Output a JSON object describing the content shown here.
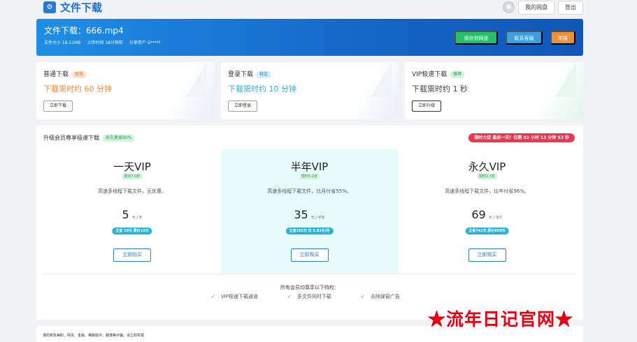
{
  "brand": {
    "logo_glyph": "⚙",
    "name": "文件下载"
  },
  "topbar": {
    "my_disk": "我的网盘",
    "logout": "登出"
  },
  "file": {
    "title": "文件下载：666.mp4",
    "size": "文件大小 18.51MB",
    "upload_time": "上传时间 18分钟前",
    "sharer": "分享用户 G****l"
  },
  "header_buttons": {
    "save": "保存到网盘",
    "contact": "联系客服",
    "report": "举报"
  },
  "download_options": [
    {
      "title": "普通下载",
      "badge": "极慢",
      "time": "下载需时约 60 分钟",
      "button": "立即下载"
    },
    {
      "title": "登录下载",
      "badge": "稳定",
      "time": "下载需时约 10 分钟",
      "button": "立即登录"
    },
    {
      "title": "VIP极速下载",
      "badge": "推荐",
      "time": "下载需时约 1 秒",
      "button": "立即升级"
    }
  ],
  "vip": {
    "title": "升级会员尊享极速下载",
    "title_badge": "永久更省90%",
    "promo": "限时大促 最后一天！仅剩 02 小时 13 分钟 53 秒",
    "plans": [
      {
        "name": "一天VIP",
        "tag": "限时7.0折",
        "desc": "高速多线程下载文件，无优惠。",
        "price": "5",
        "unit": "元 / 天",
        "save": "立省 10元 原价15元",
        "button": "立即购买"
      },
      {
        "name": "半年VIP",
        "tag": "限时5.2折",
        "desc": "高速多线程下载文件，比月付省55%。",
        "price": "35",
        "unit": "元 / 半年",
        "save": "立省165元 仅 5.83元/月",
        "button": "立即购买"
      },
      {
        "name": "永久VIP",
        "tag": "限时2.7折",
        "desc": "高速多线程下载文件，比年付省96%。",
        "price": "69",
        "unit": "元 / 永久",
        "save": "立省741元 原价800元",
        "button": "立即购买"
      }
    ],
    "perks_title": "所有会员均尊享以下特权：",
    "perks": [
      "VIP极速下载通道",
      "多文件同时下载",
      "去除弹窗广告"
    ]
  },
  "footer": {
    "text": "谨防刷单兼职、网贷、金融、裸聊敲诈、赌博等诈骗，请立即举报"
  },
  "watermark": "★流年日记官网★",
  "colors": {
    "brand_blue": "#1f6fd1",
    "save_green": "#27c06a",
    "contact_blue": "#3aa0e6",
    "report_orange": "#f0913a",
    "slow_orange": "#f08a3c",
    "login_teal": "#3aa9d8",
    "promo_red": "#e8384f"
  }
}
